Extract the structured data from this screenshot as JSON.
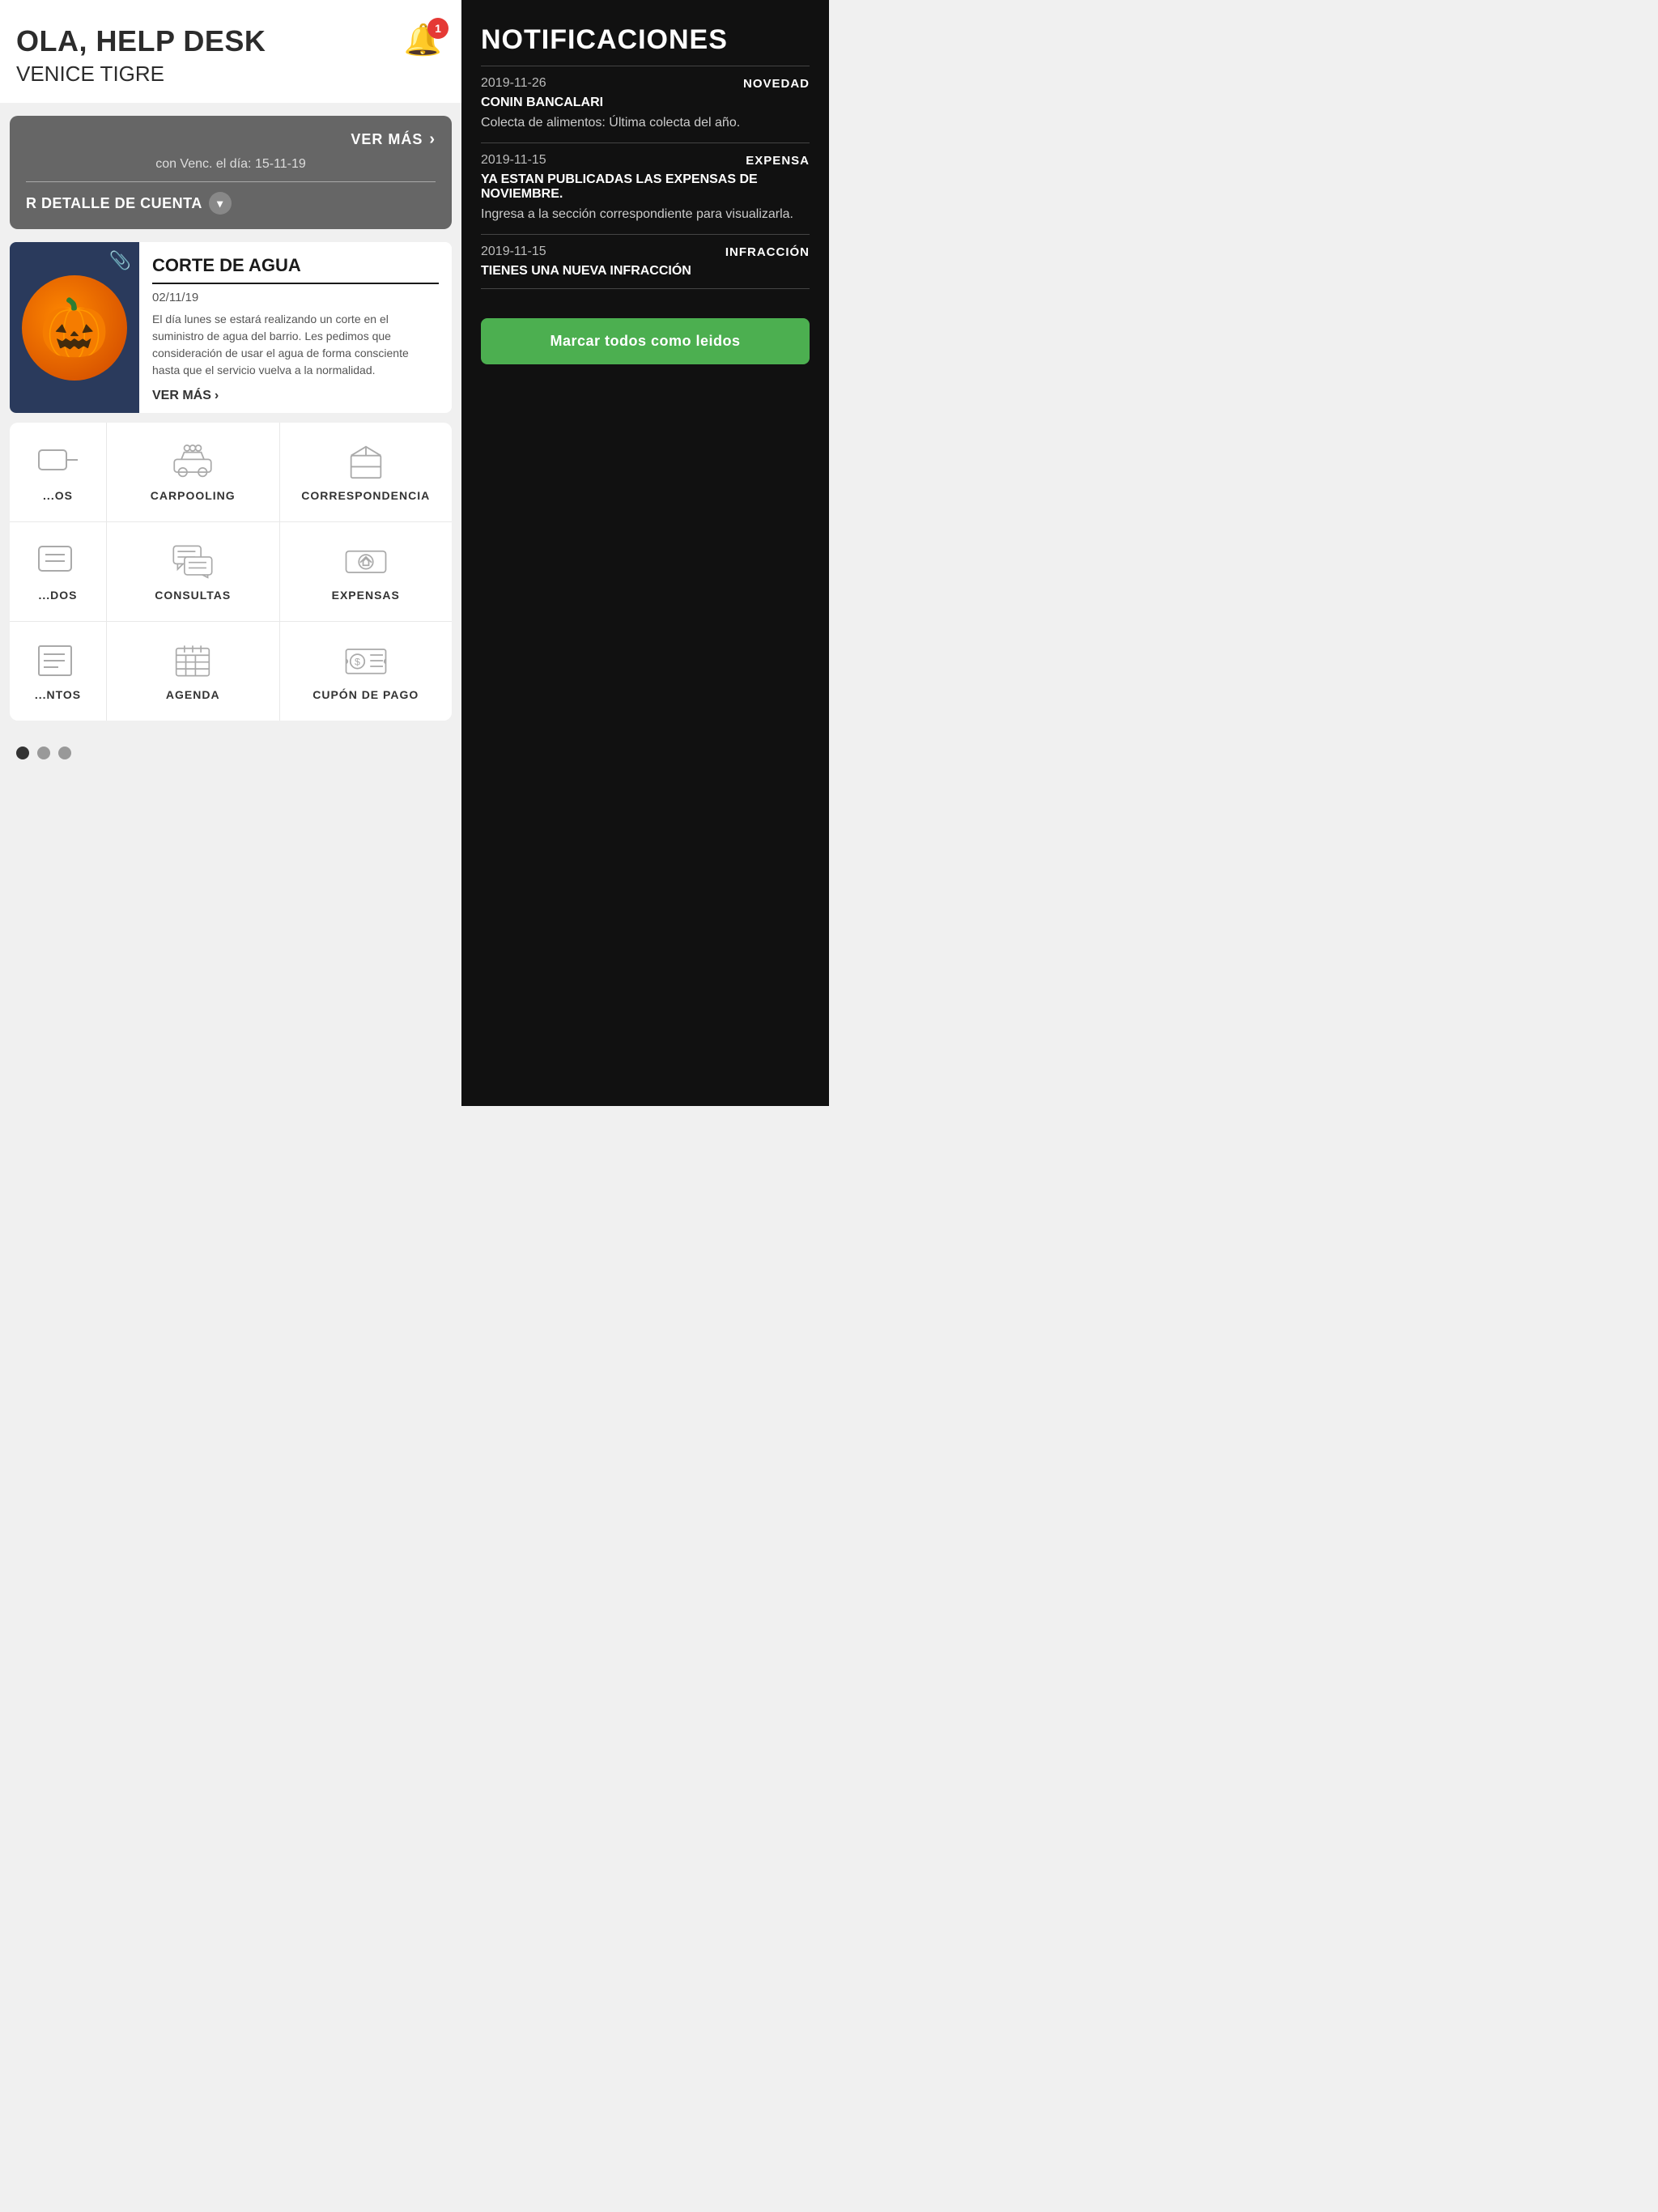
{
  "header": {
    "title": "OLA, HELP DESK",
    "subtitle": "VENICE TIGRE",
    "bell_count": "1"
  },
  "account_card": {
    "ver_mas": "VER MÁS",
    "venc_text": "con Venc. el día: 15-11-19",
    "detalle": "R DETALLE DE CUENTA"
  },
  "news": {
    "title": "CORTE DE AGUA",
    "date": "02/11/19",
    "body": "El día lunes se estará realizando un corte en el suministro de agua del barrio. Les pedimos que consideración de usar el agua de forma consciente hasta que el servicio vuelva a la normalidad.",
    "ver_mas": "VER MÁS"
  },
  "grid": {
    "rows": [
      {
        "cells": [
          {
            "id": "partial-left",
            "label": "...OS",
            "partial": true
          },
          {
            "id": "carpooling",
            "label": "CARPOOLING",
            "icon": "carpooling"
          },
          {
            "id": "correspondencia",
            "label": "CORRESPONDENCIA",
            "icon": "box"
          }
        ]
      },
      {
        "cells": [
          {
            "id": "partial-left2",
            "label": "...DOS",
            "partial": true
          },
          {
            "id": "consultas",
            "label": "CONSULTAS",
            "icon": "chat"
          },
          {
            "id": "expensas",
            "label": "EXPENSAS",
            "icon": "money"
          }
        ]
      },
      {
        "cells": [
          {
            "id": "partial-left3",
            "label": "...NTOS",
            "partial": true
          },
          {
            "id": "agenda",
            "label": "AGENDA",
            "icon": "calendar"
          },
          {
            "id": "cupon",
            "label": "CUPÓN DE PAGO",
            "icon": "coupon"
          }
        ]
      }
    ]
  },
  "pagination": {
    "total": 3,
    "active": 0
  },
  "notifications": {
    "title": "NOTIFICACIONES",
    "items": [
      {
        "date": "2019-11-26",
        "tag": "NOVEDAD",
        "sender": "CONIN BANCALARI",
        "text": "Colecta de alimentos: Última colecta del año."
      },
      {
        "date": "2019-11-15",
        "tag": "EXPENSA",
        "sender": "YA ESTAN PUBLICADAS LAS EXPENSAS DE NOVIEMBRE.",
        "text": "Ingresa a la sección correspondiente para visualizarla."
      },
      {
        "date": "2019-11-15",
        "tag": "INFRACCIÓN",
        "sender": "TIENES UNA NUEVA INFRACCIÓN",
        "text": ""
      }
    ],
    "mark_read_btn": "Marcar todos como leidos"
  }
}
